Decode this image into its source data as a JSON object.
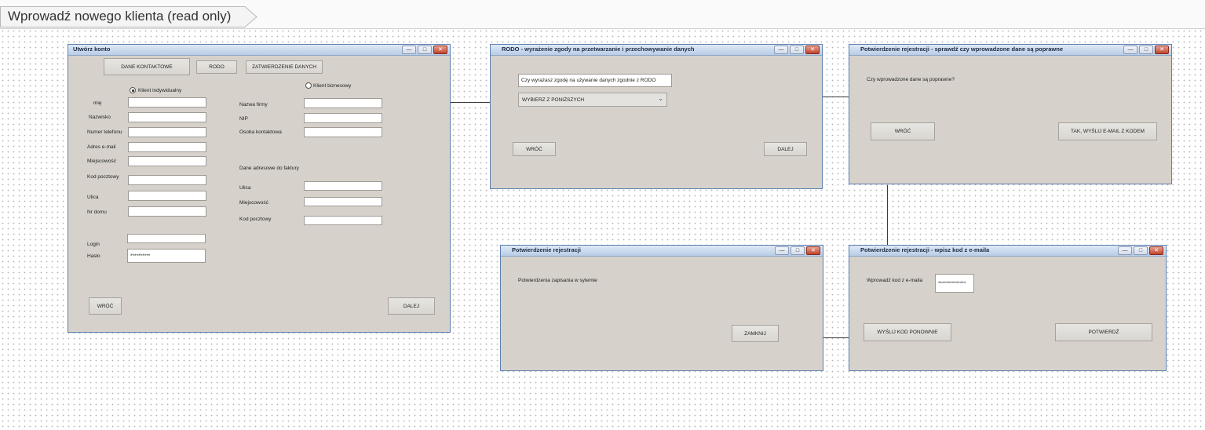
{
  "breadcrumb": {
    "title": "Wprowadź nowego klienta (read only)"
  },
  "window_controls": {
    "minimize": "—",
    "maximize": "□",
    "close": "✕"
  },
  "w1": {
    "title": "Utwórz konto",
    "tabs": [
      "DANE KONTAKTOWE",
      "RODO",
      "ZATWIERDZENIE DANYCH"
    ],
    "radio_individual": "Klient indywidualny",
    "radio_business": "Klient biznesowy",
    "left_labels": [
      "mię",
      "Nazwisko",
      "Numer telefonu",
      "Adres e-mail",
      "Miejscowość",
      "Kod pocztowy",
      "Ulica",
      "Nr domu"
    ],
    "right_labels": [
      "Nazwa firmy",
      "NIP",
      "Osoba kontaktowa"
    ],
    "invoice_header": "Dane adresowe do faktury",
    "invoice_labels": [
      "Ulica",
      "Miejscowość",
      "Kod pocztowy"
    ],
    "login_label": "Login",
    "password_label": "Hasło",
    "password_value": "**********",
    "back": "WRÓĆ",
    "next": "DALEJ"
  },
  "w2": {
    "title": "RODO - wyrażenie zgody na przetwarzanie i przechowywanie danych",
    "question": "Czy wyrażasz zgodę na używanie danych zgodnie z RODO",
    "select_value": "WYBIERZ Z PONIŻSZYCH",
    "back": "WRÓĆ",
    "next": "DALEJ"
  },
  "w3": {
    "title": "Potwierdzenie rejestracji - sprawdź czy wprowadzone dane są poprawne",
    "question": "Czy wprowadzone dane są poprawne?",
    "back": "WRÓĆ",
    "confirm": "TAK, WYŚLIJ E-MAIL Z KODEM"
  },
  "w4": {
    "title": "Potwierdzenie rejestracji",
    "message": "Potwierdzenia zapisania w sytemie",
    "close": "ZAMKNIJ"
  },
  "w5": {
    "title": "Potwierdzenie rejestracji - wpisz kod z e-maila",
    "code_label": "Wprowadź kod z e-maila",
    "code_value": "**************",
    "resend": "WYŚLIJ KOD PONOWNIE",
    "confirm": "POTWIERDŹ"
  }
}
